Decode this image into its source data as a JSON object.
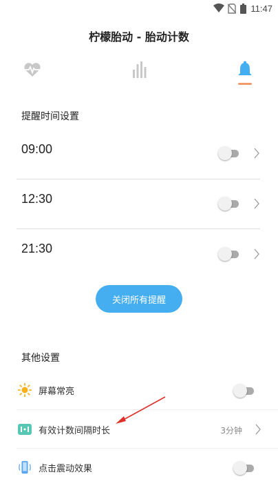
{
  "status_bar": {
    "time": "11:47",
    "icons": [
      "wifi-icon",
      "no-sim-icon",
      "battery-icon"
    ]
  },
  "app": {
    "title": "柠檬胎动 - 胎动计数"
  },
  "tabs": [
    {
      "icon": "heartbeat-icon",
      "active": false
    },
    {
      "icon": "bar-chart-icon",
      "active": false
    },
    {
      "icon": "bell-icon",
      "active": true
    }
  ],
  "colors": {
    "accent_blue": "#45aef0",
    "tab_underline": "#f39a6b",
    "inactive_icon": "#c8c8c8",
    "arrow": "#e0302a"
  },
  "reminders": {
    "section_title": "提醒时间设置",
    "items": [
      {
        "time": "09:00",
        "enabled": false
      },
      {
        "time": "12:30",
        "enabled": false
      },
      {
        "time": "21:30",
        "enabled": false
      }
    ],
    "close_all_label": "关闭所有提醒"
  },
  "other": {
    "section_title": "其他设置",
    "items": [
      {
        "icon": "sun-icon",
        "label": "屏幕常亮",
        "control": "toggle",
        "enabled": false
      },
      {
        "icon": "interval-icon",
        "label": "有效计数间隔时长",
        "control": "value",
        "value": "3分钟"
      },
      {
        "icon": "phone-vibrate-icon",
        "label": "点击震动效果",
        "control": "toggle",
        "enabled": false
      }
    ]
  }
}
